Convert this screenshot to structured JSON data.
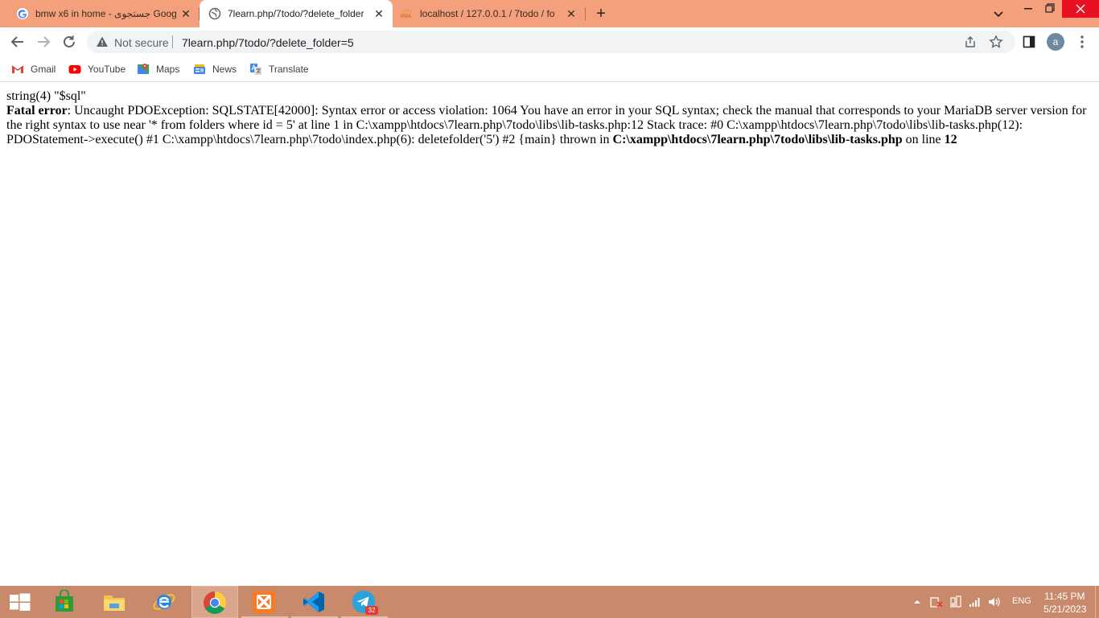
{
  "tabs": [
    {
      "title": "bmw x6 in home - جستجوی Goog",
      "favicon": "google-g-icon",
      "active": false
    },
    {
      "title": "7learn.php/7todo/?delete_folder",
      "favicon": "globe-icon",
      "active": true
    },
    {
      "title": "localhost / 127.0.0.1 / 7todo / fo",
      "favicon": "phpmyadmin-icon",
      "active": false
    }
  ],
  "toolbar": {
    "security_label": "Not secure",
    "url": "7learn.php/7todo/?delete_folder=5",
    "avatar_letter": "a"
  },
  "bookmarks": [
    {
      "label": "Gmail",
      "icon": "gmail-icon"
    },
    {
      "label": "YouTube",
      "icon": "youtube-icon"
    },
    {
      "label": "Maps",
      "icon": "maps-icon"
    },
    {
      "label": "News",
      "icon": "news-icon"
    },
    {
      "label": "Translate",
      "icon": "translate-icon"
    }
  ],
  "page": {
    "dump_line": "string(4) \"$sql\"",
    "error_label": "Fatal error",
    "error_message": ": Uncaught PDOException: SQLSTATE[42000]: Syntax error or access violation: 1064 You have an error in your SQL syntax; check the manual that corresponds to your MariaDB server version for the right syntax to use near '* from folders where id = 5' at line 1 in C:\\xampp\\htdocs\\7learn.php\\7todo\\libs\\lib-tasks.php:12 Stack trace: #0 C:\\xampp\\htdocs\\7learn.php\\7todo\\libs\\lib-tasks.php(12): PDOStatement->execute() #1 C:\\xampp\\htdocs\\7learn.php\\7todo\\index.php(6): deletefolder('5') #2 {main} thrown in ",
    "error_file": "C:\\xampp\\htdocs\\7learn.php\\7todo\\libs\\lib-tasks.php",
    "on_line_text": " on line ",
    "error_line": "12"
  },
  "taskbar": {
    "apps": [
      "start-icon",
      "store-icon",
      "file-explorer-icon",
      "internet-explorer-icon",
      "chrome-icon",
      "xampp-icon",
      "vscode-icon",
      "telegram-icon"
    ],
    "telegram_badge": "32",
    "language": "ENG",
    "time": "11:45 PM",
    "date": "5/21/2023"
  },
  "colors": {
    "tabstrip": "#f4a07c",
    "taskbar": "#c98a6c"
  }
}
